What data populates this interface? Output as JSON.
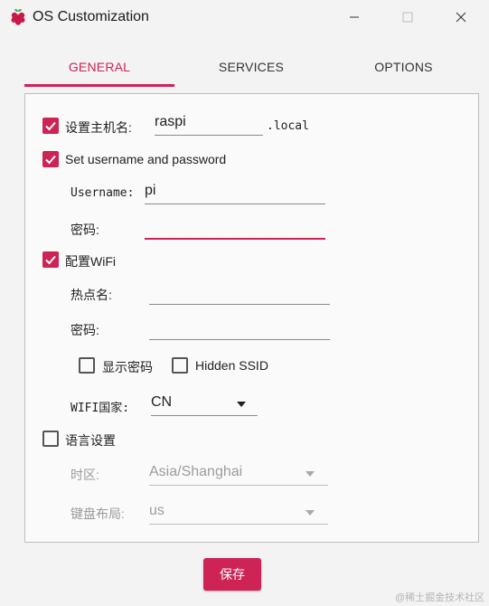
{
  "window": {
    "title": "OS Customization"
  },
  "tabs": [
    {
      "label": "GENERAL",
      "active": true
    },
    {
      "label": "SERVICES",
      "active": false
    },
    {
      "label": "OPTIONS",
      "active": false
    }
  ],
  "general": {
    "hostname": {
      "label": "设置主机名:",
      "value": "raspi",
      "suffix": ".local",
      "checked": true
    },
    "user": {
      "label": "Set username and password",
      "checked": true,
      "username_label": "Username:",
      "username_value": "pi",
      "password_label": "密码:",
      "password_value": ""
    },
    "wifi": {
      "label": "配置WiFi",
      "checked": true,
      "ssid_label": "热点名:",
      "ssid_value": "",
      "password_label": "密码:",
      "password_value": "",
      "show_password_label": "显示密码",
      "show_password_checked": false,
      "hidden_ssid_label": "Hidden SSID",
      "hidden_ssid_checked": false,
      "country_label": "WIFI国家:",
      "country_value": "CN"
    },
    "locale": {
      "label": "语言设置",
      "checked": false,
      "timezone_label": "时区:",
      "timezone_value": "Asia/Shanghai",
      "keyboard_label": "键盘布局:",
      "keyboard_value": "us"
    }
  },
  "save_label": "保存",
  "watermark": "@稀土掘金技术社区",
  "colors": {
    "accent": "#cd2355"
  }
}
